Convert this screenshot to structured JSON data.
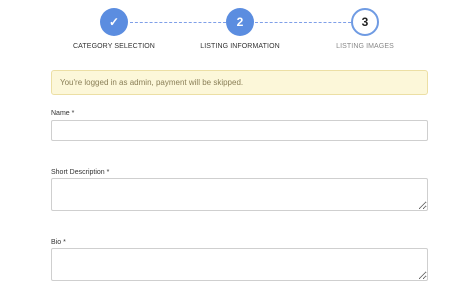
{
  "stepper": {
    "steps": [
      {
        "label": "CATEGORY SELECTION",
        "marker": "✓",
        "state": "done"
      },
      {
        "label": "LISTING INFORMATION",
        "marker": "2",
        "state": "active"
      },
      {
        "label": "LISTING IMAGES",
        "marker": "3",
        "state": "pending"
      }
    ]
  },
  "alert": {
    "text": "You're logged in as admin, payment will be skipped."
  },
  "form": {
    "name": {
      "label": "Name",
      "required_mark": "*",
      "value": ""
    },
    "short_description": {
      "label": "Short Description",
      "required_mark": "*",
      "value": ""
    },
    "bio": {
      "label": "Bio",
      "required_mark": "*",
      "value": ""
    }
  },
  "colors": {
    "accent": "#5b8de0",
    "alert_bg": "#fcf7d9",
    "alert_text": "#8a7f57"
  }
}
